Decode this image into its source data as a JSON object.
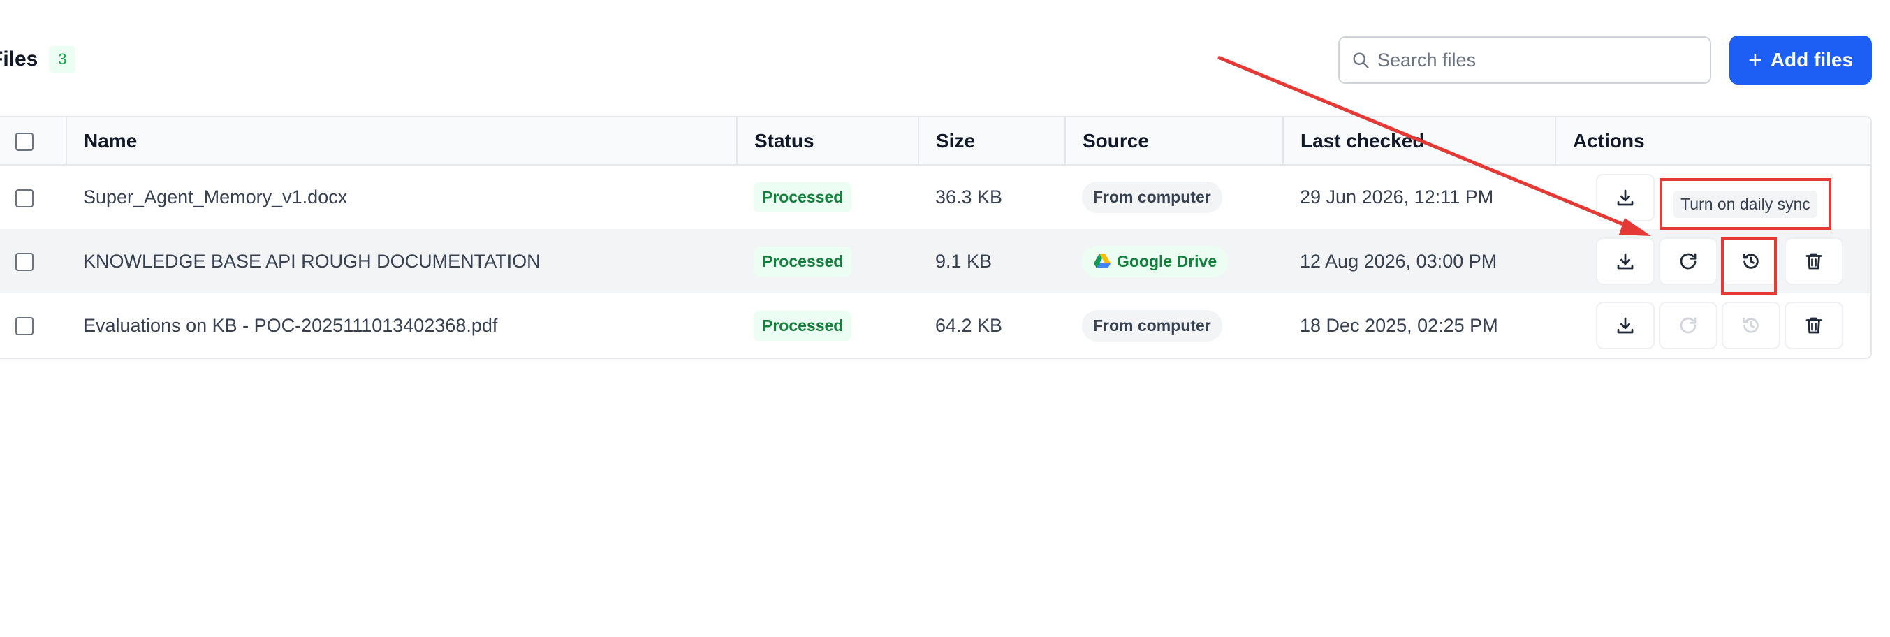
{
  "header": {
    "title": "Files",
    "count": "3",
    "search_placeholder": "Search files",
    "add_button_label": "Add files"
  },
  "table": {
    "columns": [
      "Name",
      "Status",
      "Size",
      "Source",
      "Last checked",
      "Actions"
    ],
    "rows": [
      {
        "name": "Super_Agent_Memory_v1.docx",
        "status": "Processed",
        "size": "36.3 KB",
        "source": "From computer",
        "last_checked": "29 Jun 2026, 12:11 PM"
      },
      {
        "name": "KNOWLEDGE BASE API ROUGH DOCUMENTATION",
        "status": "Processed",
        "size": "9.1 KB",
        "source": "Google Drive",
        "last_checked": "12 Aug 2026, 03:00 PM"
      },
      {
        "name": "Evaluations on KB - POC-2025111013402368.pdf",
        "status": "Processed",
        "size": "64.2 KB",
        "source": "From computer",
        "last_checked": "18 Dec 2025, 02:25 PM"
      }
    ]
  },
  "tooltip": {
    "text": "Turn on daily sync"
  },
  "colors": {
    "accent": "#1d5ef5",
    "status_green": "#15803d",
    "annotation_red": "#e53935"
  },
  "icons": [
    "search-icon",
    "plus-icon",
    "download-icon",
    "refresh-icon",
    "daily-sync-icon",
    "trash-icon",
    "google-drive-icon"
  ]
}
